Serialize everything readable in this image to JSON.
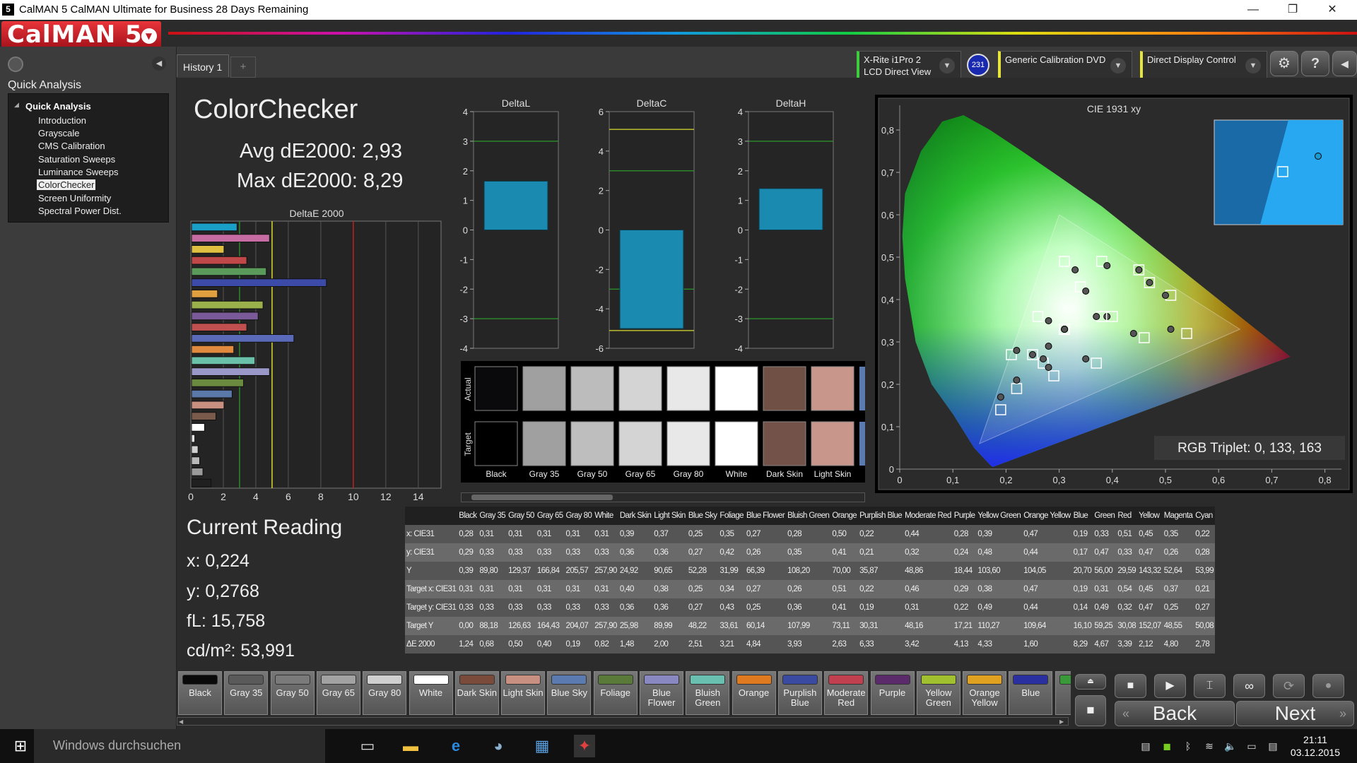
{
  "titlebar": {
    "title": "CalMAN 5 CalMAN Ultimate for Business 28 Days Remaining",
    "icon": "5",
    "min": "—",
    "max": "❐",
    "close": "✕"
  },
  "logo": "CalMAN 5",
  "sidebar": {
    "title": "Quick Analysis",
    "tree_root": "Quick Analysis",
    "items": [
      "Introduction",
      "Grayscale",
      "CMS Calibration",
      "Saturation Sweeps",
      "Luminance Sweeps",
      "ColorChecker",
      "Screen Uniformity",
      "Spectral Power Dist."
    ]
  },
  "tabs": {
    "history": "History 1",
    "add": "+"
  },
  "devices": {
    "meter_line1": "X-Rite i1Pro 2",
    "meter_line2": "LCD Direct View",
    "badge": "231",
    "source": "Generic Calibration DVD",
    "display": "Direct Display Control"
  },
  "colorchecker": {
    "title": "ColorChecker",
    "avg": "Avg dE2000: 2,93",
    "max": "Max dE2000: 8,29",
    "bar_title": "DeltaE 2000",
    "bar_xticks": [
      "0",
      "2",
      "4",
      "6",
      "8",
      "10",
      "12",
      "14"
    ],
    "bars": [
      {
        "v": 2.8,
        "c": "#1a9fc6"
      },
      {
        "v": 4.8,
        "c": "#c66ca3"
      },
      {
        "v": 2.0,
        "c": "#e0c040"
      },
      {
        "v": 3.4,
        "c": "#c04848"
      },
      {
        "v": 4.6,
        "c": "#5a9a5a"
      },
      {
        "v": 8.3,
        "c": "#3c4aa8"
      },
      {
        "v": 1.6,
        "c": "#e0a040"
      },
      {
        "v": 4.4,
        "c": "#9ab04a"
      },
      {
        "v": 4.1,
        "c": "#7a5a98"
      },
      {
        "v": 3.4,
        "c": "#c05050"
      },
      {
        "v": 6.3,
        "c": "#5a6ab8"
      },
      {
        "v": 2.6,
        "c": "#e08a40"
      },
      {
        "v": 3.9,
        "c": "#6ac0a8"
      },
      {
        "v": 4.8,
        "c": "#9a98c8"
      },
      {
        "v": 3.2,
        "c": "#6a8a40"
      },
      {
        "v": 2.5,
        "c": "#5a78a8"
      },
      {
        "v": 2.0,
        "c": "#c89080"
      },
      {
        "v": 1.5,
        "c": "#7a5a4a"
      },
      {
        "v": 0.8,
        "c": "#ffffff"
      },
      {
        "v": 0.2,
        "c": "#e8e8e8"
      },
      {
        "v": 0.4,
        "c": "#d0d0d0"
      },
      {
        "v": 0.5,
        "c": "#b8b8b8"
      },
      {
        "v": 0.7,
        "c": "#9a9a9a"
      },
      {
        "v": 1.2,
        "c": "#202020"
      }
    ],
    "deltaL": {
      "title": "DeltaL",
      "ticks": [
        "4",
        "3",
        "2",
        "1",
        "0",
        "-1",
        "-2",
        "-3",
        "-4"
      ]
    },
    "deltaC": {
      "title": "DeltaC",
      "ticks": [
        "6",
        "4",
        "2",
        "0",
        "-2",
        "-4",
        "-6"
      ]
    },
    "deltaH": {
      "title": "DeltaH",
      "ticks": [
        "4",
        "3",
        "2",
        "1",
        "0",
        "-1",
        "-2",
        "-3",
        "-4"
      ]
    },
    "actual_label": "Actual",
    "target_label": "Target",
    "patches": [
      {
        "name": "Black",
        "actual": "#0a0a0c",
        "target": "#000000"
      },
      {
        "name": "Gray 35",
        "actual": "#a0a0a0",
        "target": "#a0a0a0"
      },
      {
        "name": "Gray 50",
        "actual": "#bcbcbc",
        "target": "#bebebe"
      },
      {
        "name": "Gray 65",
        "actual": "#d4d4d4",
        "target": "#d4d4d4"
      },
      {
        "name": "Gray 80",
        "actual": "#e8e8e8",
        "target": "#e8e8e8"
      },
      {
        "name": "White",
        "actual": "#ffffff",
        "target": "#ffffff"
      },
      {
        "name": "Dark Skin",
        "actual": "#705044",
        "target": "#73524a"
      },
      {
        "name": "Light Skin",
        "actual": "#c8968a",
        "target": "#c8968a"
      }
    ]
  },
  "cie": {
    "title": "CIE 1931 xy",
    "rgb_triplet": "RGB Triplet: 0, 133, 163",
    "xticks": [
      "0",
      "0,1",
      "0,2",
      "0,3",
      "0,4",
      "0,5",
      "0,6",
      "0,7",
      "0,8"
    ],
    "yticks": [
      "0",
      "0,1",
      "0,2",
      "0,3",
      "0,4",
      "0,5",
      "0,6",
      "0,7",
      "0,8"
    ]
  },
  "current": {
    "title": "Current Reading",
    "x": "x: 0,224",
    "y": "y: 0,2768",
    "fl": "fL: 15,758",
    "cd": "cd/m²: 53,991"
  },
  "table": {
    "headers": [
      "Black",
      "Gray 35",
      "Gray 50",
      "Gray 65",
      "Gray 80",
      "White",
      "Dark Skin",
      "Light Skin",
      "Blue Sky",
      "Foliage",
      "Blue Flower",
      "Bluish Green",
      "Orange",
      "Purplish Blue",
      "Moderate Red",
      "Purple",
      "Yellow Green",
      "Orange Yellow",
      "Blue",
      "Green",
      "Red",
      "Yellow",
      "Magenta",
      "Cyan"
    ],
    "rows": [
      {
        "label": "x: CIE31",
        "values": [
          "0,28",
          "0,31",
          "0,31",
          "0,31",
          "0,31",
          "0,31",
          "0,39",
          "0,37",
          "0,25",
          "0,35",
          "0,27",
          "0,28",
          "0,50",
          "0,22",
          "0,44",
          "0,28",
          "0,39",
          "0,47",
          "0,19",
          "0,33",
          "0,51",
          "0,45",
          "0,35",
          "0,22"
        ]
      },
      {
        "label": "y: CIE31",
        "values": [
          "0,29",
          "0,33",
          "0,33",
          "0,33",
          "0,33",
          "0,33",
          "0,36",
          "0,36",
          "0,27",
          "0,42",
          "0,26",
          "0,35",
          "0,41",
          "0,21",
          "0,32",
          "0,24",
          "0,48",
          "0,44",
          "0,17",
          "0,47",
          "0,33",
          "0,47",
          "0,26",
          "0,28"
        ]
      },
      {
        "label": "Y",
        "values": [
          "0,39",
          "89,80",
          "129,37",
          "166,84",
          "205,57",
          "257,90",
          "24,92",
          "90,65",
          "52,28",
          "31,99",
          "66,39",
          "108,20",
          "70,00",
          "35,87",
          "48,86",
          "18,44",
          "103,60",
          "104,05",
          "20,70",
          "56,00",
          "29,59",
          "143,32",
          "52,64",
          "53,99"
        ]
      },
      {
        "label": "Target x: CIE31",
        "values": [
          "0,31",
          "0,31",
          "0,31",
          "0,31",
          "0,31",
          "0,31",
          "0,40",
          "0,38",
          "0,25",
          "0,34",
          "0,27",
          "0,26",
          "0,51",
          "0,22",
          "0,46",
          "0,29",
          "0,38",
          "0,47",
          "0,19",
          "0,31",
          "0,54",
          "0,45",
          "0,37",
          "0,21"
        ]
      },
      {
        "label": "Target y: CIE31",
        "values": [
          "0,33",
          "0,33",
          "0,33",
          "0,33",
          "0,33",
          "0,33",
          "0,36",
          "0,36",
          "0,27",
          "0,43",
          "0,25",
          "0,36",
          "0,41",
          "0,19",
          "0,31",
          "0,22",
          "0,49",
          "0,44",
          "0,14",
          "0,49",
          "0,32",
          "0,47",
          "0,25",
          "0,27"
        ]
      },
      {
        "label": "Target Y",
        "values": [
          "0,00",
          "88,18",
          "126,63",
          "164,43",
          "204,07",
          "257,90",
          "25,98",
          "89,99",
          "48,22",
          "33,61",
          "60,14",
          "107,99",
          "73,11",
          "30,31",
          "48,16",
          "17,21",
          "110,27",
          "109,64",
          "16,10",
          "59,25",
          "30,08",
          "152,07",
          "48,55",
          "50,08"
        ]
      },
      {
        "label": "ΔE 2000",
        "values": [
          "1,24",
          "0,68",
          "0,50",
          "0,40",
          "0,19",
          "0,82",
          "1,48",
          "2,00",
          "2,51",
          "3,21",
          "4,84",
          "3,93",
          "2,63",
          "6,33",
          "3,42",
          "4,13",
          "4,33",
          "1,60",
          "8,29",
          "4,67",
          "3,39",
          "2,12",
          "4,80",
          "2,78"
        ]
      }
    ]
  },
  "swatches": [
    {
      "label": "Black",
      "c": "#0a0a0a"
    },
    {
      "label": "Gray 35",
      "c": "#5a5a5a"
    },
    {
      "label": "Gray 50",
      "c": "#7a7a7a"
    },
    {
      "label": "Gray 65",
      "c": "#a2a2a2"
    },
    {
      "label": "Gray 80",
      "c": "#cfcfcf"
    },
    {
      "label": "White",
      "c": "#ffffff"
    },
    {
      "label": "Dark Skin",
      "c": "#7a4a3a"
    },
    {
      "label": "Light Skin",
      "c": "#c89080"
    },
    {
      "label": "Blue Sky",
      "c": "#5a7ab0"
    },
    {
      "label": "Foliage",
      "c": "#5a7a3a"
    },
    {
      "label": "Blue Flower",
      "c": "#8a88c0"
    },
    {
      "label": "Bluish Green",
      "c": "#6ac0b0"
    },
    {
      "label": "Orange",
      "c": "#e07a20"
    },
    {
      "label": "Purplish Blue",
      "c": "#3a4aa0"
    },
    {
      "label": "Moderate Red",
      "c": "#c04050"
    },
    {
      "label": "Purple",
      "c": "#5a2a6a"
    },
    {
      "label": "Yellow Green",
      "c": "#a0c030"
    },
    {
      "label": "Orange Yellow",
      "c": "#e0a020"
    },
    {
      "label": "Blue",
      "c": "#2a30a0"
    },
    {
      "label": "Gr",
      "c": "#3a9a3a"
    }
  ],
  "nav": {
    "back": "Back",
    "next": "Next"
  },
  "taskbar": {
    "search": "Windows durchsuchen",
    "time": "21:11",
    "date": "03.12.2015"
  }
}
